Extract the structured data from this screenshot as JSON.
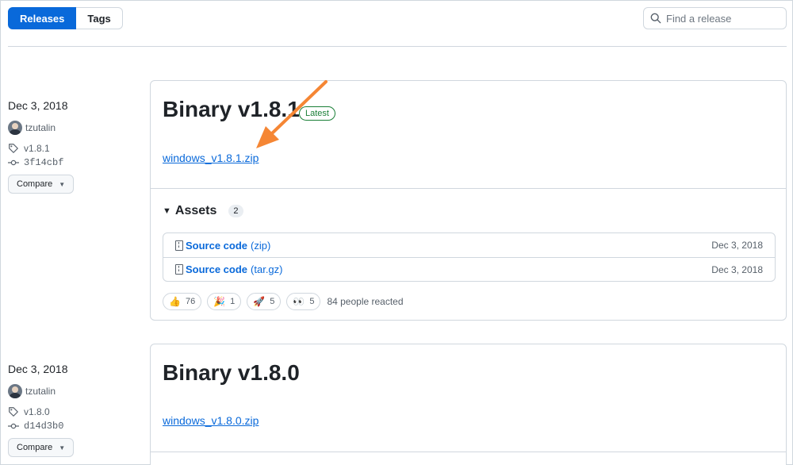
{
  "tabs": [
    {
      "label": "Releases",
      "active": true
    },
    {
      "label": "Tags",
      "active": false
    }
  ],
  "search": {
    "placeholder": "Find a release",
    "icon": "search-icon"
  },
  "releases": [
    {
      "date": "Dec 3, 2018",
      "author": "tzutalin",
      "tag": "v1.8.1",
      "commit": "3f14cbf",
      "compare_label": "Compare",
      "title": "Binary v1.8.1",
      "badge": "Latest",
      "link": "windows_v1.8.1.zip",
      "assets_label": "Assets",
      "assets_count": "2",
      "assets": [
        {
          "name": "Source code",
          "format": "(zip)",
          "date": "Dec 3, 2018"
        },
        {
          "name": "Source code",
          "format": "(tar.gz)",
          "date": "Dec 3, 2018"
        }
      ],
      "reactions": [
        {
          "emoji": "👍",
          "icon": "thumbs-up-icon",
          "count": "76"
        },
        {
          "emoji": "🎉",
          "icon": "party-popper-icon",
          "count": "1"
        },
        {
          "emoji": "🚀",
          "icon": "rocket-icon",
          "count": "5"
        },
        {
          "emoji": "👀",
          "icon": "eyes-icon",
          "count": "5"
        }
      ],
      "reactions_summary": "84 people reacted"
    },
    {
      "date": "Dec 3, 2018",
      "author": "tzutalin",
      "tag": "v1.8.0",
      "commit": "d14d3b0",
      "compare_label": "Compare",
      "title": "Binary v1.8.0",
      "link": "windows_v1.8.0.zip"
    }
  ],
  "colors": {
    "accent": "#0969da",
    "latest": "#1a7f37",
    "annotation_arrow": "#f58634"
  }
}
